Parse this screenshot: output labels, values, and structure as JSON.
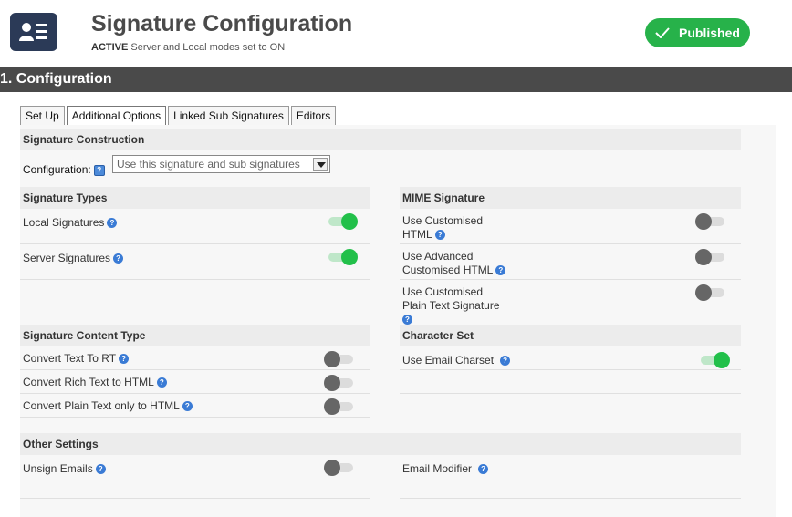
{
  "header": {
    "title": "Signature Configuration",
    "subtitle_active": "ACTIVE",
    "subtitle_text": " Server and Local modes set to ON",
    "status_label": "Published"
  },
  "section": {
    "title": "1. Configuration"
  },
  "tabs": [
    {
      "label": "Set Up"
    },
    {
      "label": "Additional Options"
    },
    {
      "label": "Linked Sub Signatures"
    },
    {
      "label": "Editors"
    }
  ],
  "construction": {
    "heading": "Signature Construction",
    "config_label": "Configuration:",
    "config_value": "Use this signature and sub signatures"
  },
  "signature_types": {
    "heading": "Signature Types",
    "items": [
      {
        "label": "Local Signatures",
        "on": true
      },
      {
        "label": "Server Signatures",
        "on": true
      }
    ]
  },
  "mime": {
    "heading": "MIME Signature",
    "items": [
      {
        "label_line1": "Use Customised",
        "label_line2": "HTML",
        "on": false
      },
      {
        "label_line1": "Use Advanced",
        "label_line2": "Customised HTML",
        "on": false
      },
      {
        "label_line1": "Use Customised",
        "label_line2": "Plain Text Signature",
        "on": false
      }
    ]
  },
  "content_type": {
    "heading": "Signature Content Type",
    "items": [
      {
        "label": "Convert Text To RT",
        "on": false
      },
      {
        "label": "Convert Rich Text to HTML",
        "on": false
      },
      {
        "label": "Convert Plain Text only to HTML",
        "on": false
      }
    ]
  },
  "charset": {
    "heading": "Character Set",
    "items": [
      {
        "label": "Use Email Charset",
        "on": true
      }
    ]
  },
  "other": {
    "heading": "Other Settings",
    "unsign_label": "Unsign Emails",
    "unsign_on": false,
    "modifier_label": "Email Modifier"
  },
  "colors": {
    "published": "#27b24a",
    "section_bar": "#4a4a4a",
    "toggle_on": "#22c04a",
    "toggle_off": "#666666",
    "help_icon": "#3a7bd5"
  },
  "help_glyph": "?"
}
